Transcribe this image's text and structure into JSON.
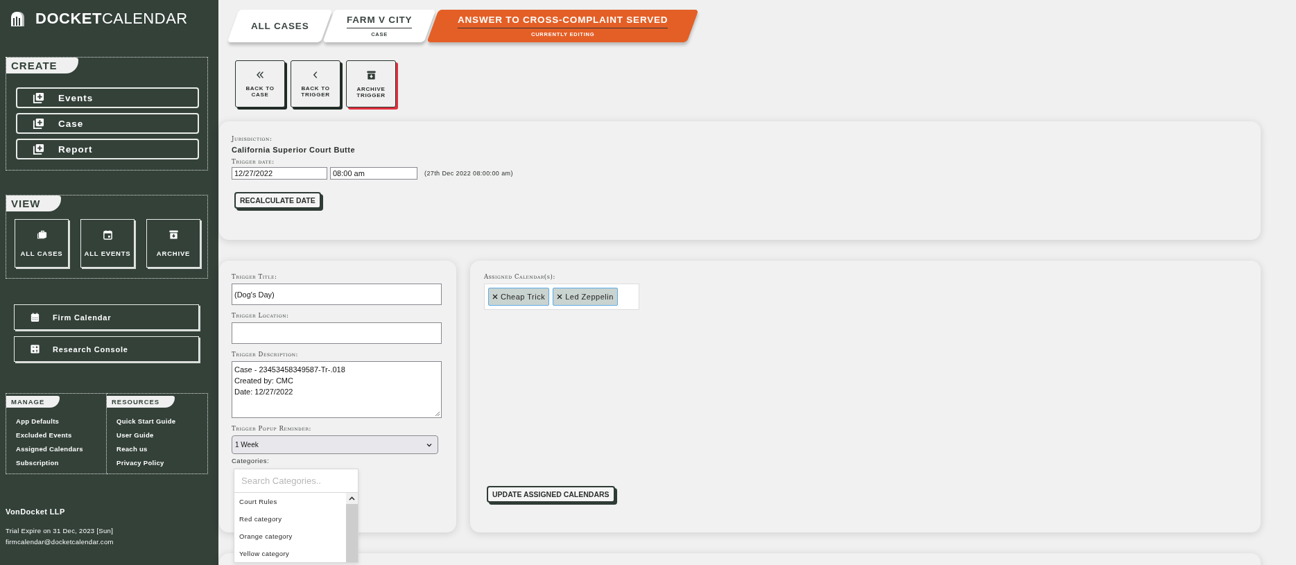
{
  "brand": {
    "bold": "DOCKET",
    "light": "CALENDAR"
  },
  "sidebar": {
    "create": {
      "title": "CREATE",
      "items": [
        "Events",
        "Case",
        "Report"
      ]
    },
    "view": {
      "title": "VIEW",
      "items": [
        {
          "label": "ALL CASES",
          "kind": "briefcase"
        },
        {
          "label": "ALL EVENTS",
          "kind": "calendar"
        },
        {
          "label": "ARCHIVE",
          "kind": "archive"
        }
      ]
    },
    "tools": [
      {
        "label": "Firm Calendar",
        "kind": "calendar"
      },
      {
        "label": "Research Console",
        "kind": "calculator"
      }
    ],
    "manage": {
      "title": "MANAGE",
      "links": [
        "App Defaults",
        "Excluded Events",
        "Assigned Calendars",
        "Subscription"
      ]
    },
    "resources": {
      "title": "RESOURCES",
      "links": [
        "Quick Start Guide",
        "User Guide",
        "Reach us",
        "Privacy Policy"
      ]
    },
    "account": {
      "firm": "VonDocket LLP",
      "trial": "Trial Expire on 31 Dec, 2023 [Sun]",
      "email": "firmcalendar@docketcalendar.com"
    }
  },
  "breadcrumbs": [
    {
      "title": "ALL CASES",
      "selected": false
    },
    {
      "title": "FARM V CITY",
      "subtitle": "CASE",
      "selected": false
    },
    {
      "title": "ANSWER TO CROSS-COMPLAINT SERVED",
      "subtitle": "CURRENTLY EDITING",
      "selected": true
    }
  ],
  "actions": [
    {
      "label": "BACK TO CASE",
      "kind": "default"
    },
    {
      "label": "BACK TO TRIGGER",
      "kind": "default"
    },
    {
      "label": "ARCHIVE TRIGGER",
      "kind": "danger"
    }
  ],
  "trigger": {
    "jurisdiction_label": "Jurisdiction:",
    "jurisdiction": "California Superior Court Butte",
    "date_label": "Trigger date:",
    "date": "12/27/2022",
    "time": "08:00 am",
    "date_readable": "(27th Dec 2022 08:00:00 am)",
    "recalculate": "RECALCULATE DATE"
  },
  "form": {
    "fields": [
      {
        "kind": "input",
        "label": "Trigger Title:",
        "value": "(Dog's Day)"
      },
      {
        "kind": "input",
        "label": "Trigger Location:"
      },
      {
        "kind": "textarea",
        "label": "Trigger Description:",
        "value": "Case - 23453458349587-Tr-.018\nCreated by: CMC\nDate: 12/27/2022"
      },
      {
        "kind": "select",
        "label": "Trigger Popup Reminder:",
        "value": "1 Week"
      }
    ],
    "categories": {
      "label": "Categories:",
      "placeholder": "Search Categories..",
      "options": [
        "Court Rules",
        "Red category",
        "Orange category",
        "Yellow category"
      ]
    }
  },
  "calendars": {
    "label": "Assigned Calendar(s):",
    "tags": [
      "Cheap Trick",
      "Led Zeppelin"
    ],
    "button": "UPDATE ASSIGNED CALENDARS"
  }
}
